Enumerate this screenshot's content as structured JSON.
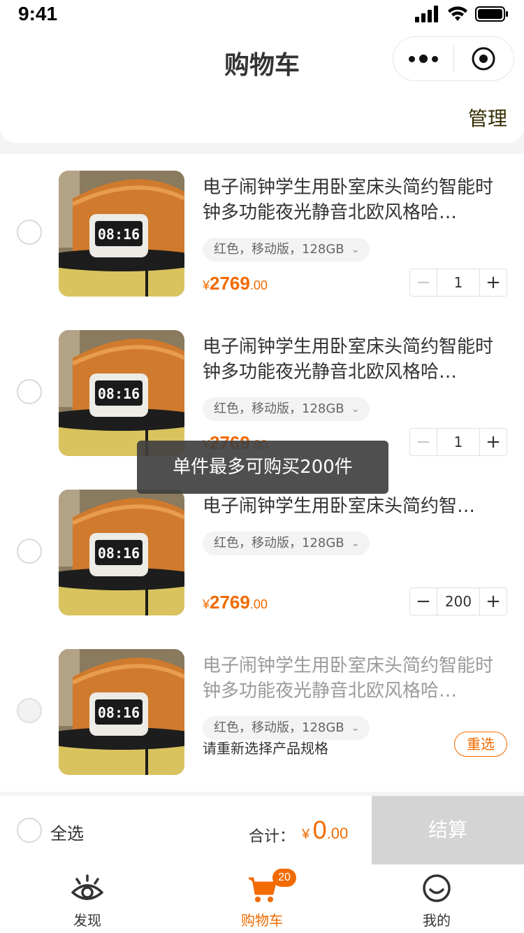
{
  "status_bar": {
    "time": "9:41"
  },
  "header": {
    "title": "购物车",
    "manage_label": "管理"
  },
  "toast": "单件最多可购买200件",
  "items": [
    {
      "name": "电子闹钟学生用卧室床头简约智能时钟多功能夜光静音北欧风格哈…",
      "spec": "红色，移动版，128GB",
      "price_currency": "¥",
      "price_int": "2769",
      "price_dec": ".00",
      "quantity": "1"
    },
    {
      "name": "电子闹钟学生用卧室床头简约智能时钟多功能夜光静音北欧风格哈…",
      "spec": "红色，移动版，128GB",
      "price_currency": "¥",
      "price_int": "2769",
      "price_dec": ".00",
      "quantity": "1"
    },
    {
      "name": "电子闹钟学生用卧室床头简约智…",
      "spec": "红色，移动版，128GB",
      "price_currency": "¥",
      "price_int": "2769",
      "price_dec": ".00",
      "quantity": "200"
    },
    {
      "name": "电子闹钟学生用卧室床头简约智能时钟多功能夜光静音北欧风格哈…",
      "spec": "红色，移动版，128GB",
      "tip": "请重新选择产品规格",
      "reselect_label": "重选"
    }
  ],
  "stepper": {
    "minus": "−",
    "plus": "+"
  },
  "thumb_clock_text": "08:16",
  "checkout": {
    "select_all_label": "全选",
    "total_label": "合计：",
    "total_currency": "¥",
    "total_int": "0",
    "total_dec": ".00",
    "submit_label": "结算"
  },
  "tabs": [
    {
      "label": "发现",
      "icon": "eye-icon"
    },
    {
      "label": "购物车",
      "icon": "cart-icon",
      "badge": "20",
      "active": true
    },
    {
      "label": "我的",
      "icon": "smiley-icon"
    }
  ],
  "colors": {
    "accent": "#f16b00",
    "disabled_button": "#d4d4d4",
    "toast_bg": "#404040"
  }
}
